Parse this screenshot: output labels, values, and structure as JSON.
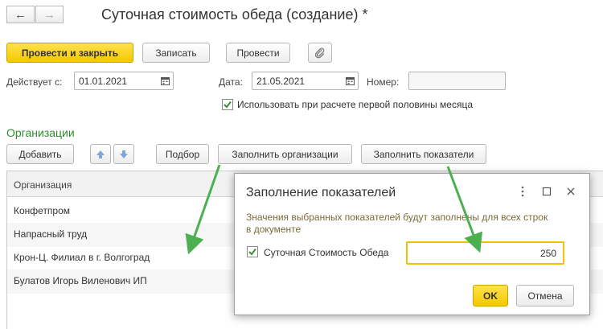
{
  "nav": {
    "back": "←",
    "forward": "→"
  },
  "title": "Суточная стоимость обеда (создание) *",
  "toolbar": {
    "post_close": "Провести и закрыть",
    "save": "Записать",
    "post": "Провести"
  },
  "form": {
    "valid_from_label": "Действует с:",
    "valid_from_value": "01.01.2021",
    "date_label": "Дата:",
    "date_value": "21.05.2021",
    "number_label": "Номер:",
    "number_value": "",
    "first_half_label": "Использовать при расчете первой половины месяца",
    "first_half_checked": true
  },
  "orgs": {
    "title": "Организации",
    "add": "Добавить",
    "pick": "Подбор",
    "fill_orgs": "Заполнить организации",
    "fill_indicators": "Заполнить показатели",
    "column": "Организация",
    "rows": [
      "Конфетпром",
      "Напрасный труд",
      "Крон-Ц. Филиал в г. Волгоград",
      "Булатов Игорь Виленович ИП"
    ]
  },
  "dialog": {
    "title": "Заполнение показателей",
    "message": "Значения выбранных показателей будут заполнены для всех строк в документе",
    "indicator_label": "Суточная Стоимость Обеда",
    "indicator_value": "250",
    "ok": "OK",
    "cancel": "Отмена"
  },
  "colors": {
    "primary": "#f4c800",
    "section_title": "#2e8b2e",
    "arrow": "#4caf50",
    "message": "#7a6a3a"
  }
}
